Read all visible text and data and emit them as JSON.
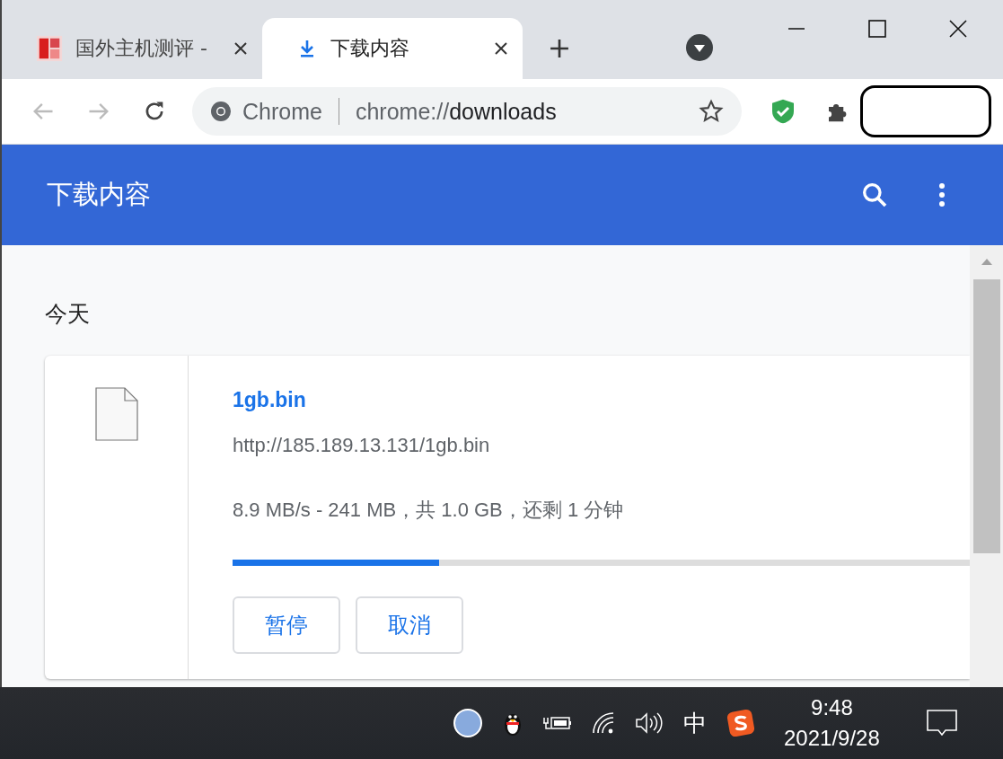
{
  "tabs": [
    {
      "title": "国外主机测评 -",
      "selected": false,
      "kind": "site"
    },
    {
      "title": "下载内容",
      "selected": true,
      "kind": "download"
    }
  ],
  "omnibox": {
    "chip": "Chrome",
    "url_scheme": "chrome://",
    "url_host": "downloads"
  },
  "header": {
    "title": "下载内容"
  },
  "section": {
    "title": "今天"
  },
  "download": {
    "filename": "1gb.bin",
    "url": "http://185.189.13.131/1gb.bin",
    "status": "8.9 MB/s - 241 MB，共 1.0 GB，还剩 1 分钟",
    "level": 0.28,
    "buttons": [
      "暂停",
      "取消"
    ]
  },
  "taskbar": {
    "ime": "中",
    "time": "9:48",
    "date": "2021/9/28"
  }
}
